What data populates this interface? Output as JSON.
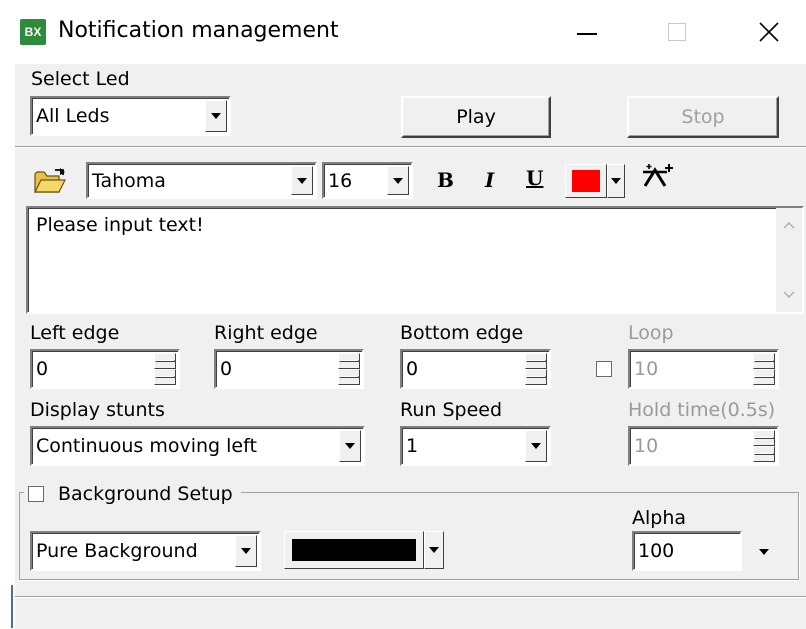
{
  "window": {
    "title": "Notification management",
    "app_icon": "BX"
  },
  "led": {
    "label": "Select Led",
    "selected": "All Leds",
    "play_label": "Play",
    "stop_label": "Stop"
  },
  "format": {
    "font": "Tahoma",
    "size": "16",
    "bold_label": "B",
    "italic_label": "I",
    "underline_label": "U",
    "color": "#ff0000"
  },
  "text_area": {
    "value": "Please input text!"
  },
  "edges": {
    "left_label": "Left edge",
    "left_value": "0",
    "right_label": "Right edge",
    "right_value": "0",
    "bottom_label": "Bottom edge",
    "bottom_value": "0",
    "loop_label": "Loop",
    "loop_value": "10"
  },
  "display": {
    "stunts_label": "Display stunts",
    "stunts_value": "Continuous moving left",
    "speed_label": "Run Speed",
    "speed_value": "1",
    "hold_label": "Hold time(0.5s)",
    "hold_value": "10"
  },
  "background": {
    "group_label": "Background Setup",
    "type_value": "Pure Background",
    "color": "#000000",
    "alpha_label": "Alpha",
    "alpha_value": "100"
  }
}
